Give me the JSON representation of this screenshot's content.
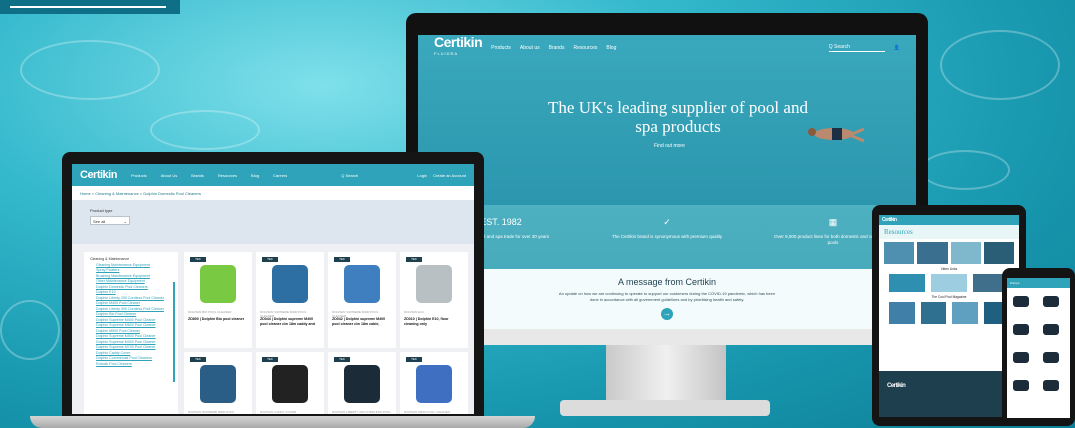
{
  "monitor": {
    "brand": "Certikin",
    "brand_sub": "FLUIDRA",
    "nav": [
      "Products",
      "About us",
      "Brands",
      "Resources",
      "Blog"
    ],
    "search_placeholder": "Q Search",
    "hero_title": "The UK's leading supplier of pool and spa products",
    "hero_link": "Find out more",
    "stats": [
      {
        "head": "EST. 1982",
        "text": "Serving the pool and spa trade for over 30 years"
      },
      {
        "head": "✓",
        "text": "The Certikin brand is synonymous with premium quality"
      },
      {
        "head": "▦",
        "text": "Over 8,000 product lines for both domestic and commercial pools"
      }
    ],
    "message_title": "A message from Certikin",
    "message_text": "An update on how we are continuing to operate to support our customers during the COVID-19 pandemic, which has been done in accordance with all government guidelines and by prioritising health and safety."
  },
  "laptop": {
    "brand": "Certikin",
    "brand_sub": "FLUIDRA",
    "nav": [
      "Products",
      "About Us",
      "Brands",
      "Resources",
      "Blog",
      "Careers"
    ],
    "search_placeholder": "Q Search",
    "login": "Login",
    "trade": "Create an Account",
    "breadcrumb": "Home > Cleaning & Maintenance > Dolphin Domestic Pool Cleaners",
    "filter_label": "Product type",
    "filter_value": "See all",
    "sidebar_head": "Cleaning & Maintenance",
    "sidebar_items": [
      "Cleaning Maintenance Equipment",
      "Spray Floaters",
      "Brushing Maintenance Equipment",
      "Other Maintenance Equipment",
      "Dolphin Domestic Pool Cleaners",
      "Dolphin E10",
      "Dolphin Liberty 200 Cordless Pool Cleaner",
      "Dolphin M400 Pool Cleaner",
      "Dolphin Liberty 300 Cordless Pool Cleaner",
      "Dolphin Bio Pool Cleaner",
      "Dolphin Supreme M400 Pool Cleaner",
      "Dolphin Supreme M600 Pool Cleaner",
      "Dolphin M500 Pool Cleaner",
      "Dolphin Supreme M500 Pool Cleaner",
      "Dolphin Supreme M300 Pool Cleaner",
      "Dolphin Supreme M700 Pool Cleaner",
      "Dolphin Caddy Cover",
      "Dolphin Commercial Pool Cleaners",
      "Robotic Pool Cleaners"
    ],
    "products": [
      {
        "badge": "TEK",
        "brand": "DOLPHIN BIO POOL CLEANER",
        "name": "ZD800 | Dolphin Bio pool cleaner",
        "color": "#7ac943"
      },
      {
        "badge": "TEK",
        "brand": "DOLPHIN SUPREME M400 POOL CLEANER",
        "name": "ZD044 | Dolphin supreme M400 pool cleaner c/w 18m caddy and",
        "color": "#2e6fa3"
      },
      {
        "badge": "TEK",
        "brand": "DOLPHIN SUPREME M400 POOL CLEANER",
        "name": "ZD042 | Dolphin supreme M400 pool cleaner c/w 18m cable,",
        "color": "#3f7fbf"
      },
      {
        "badge": "TEK",
        "brand": "DOLPHIN E10",
        "name": "ZD010 | Dolphin E10, floor cleaning only",
        "color": "#b9c0c4"
      },
      {
        "badge": "TEK",
        "brand": "DOLPHIN SUPREME M600 POOL",
        "name": "",
        "color": "#2a5e86"
      },
      {
        "badge": "TEK",
        "brand": "DOLPHIN CADDY COVER",
        "name": "",
        "color": "#222222"
      },
      {
        "badge": "TEK",
        "brand": "DOLPHIN LIBERTY 200 CORDLESS POOL",
        "name": "",
        "color": "#1b2b38"
      },
      {
        "badge": "TEK",
        "brand": "DOLPHIN M500 POOL CLEANER",
        "name": "",
        "color": "#3f6fc0"
      }
    ]
  },
  "tablet": {
    "banner": "Resources",
    "section1": "Video Links",
    "section2": "The Cool Pool Magazine",
    "footer_brand": "Certikin"
  },
  "phone": {
    "title": "Pumps"
  },
  "colors": {
    "brand": "#2ea3b9",
    "dark": "#1e3f4d",
    "water": "#1796ad"
  }
}
